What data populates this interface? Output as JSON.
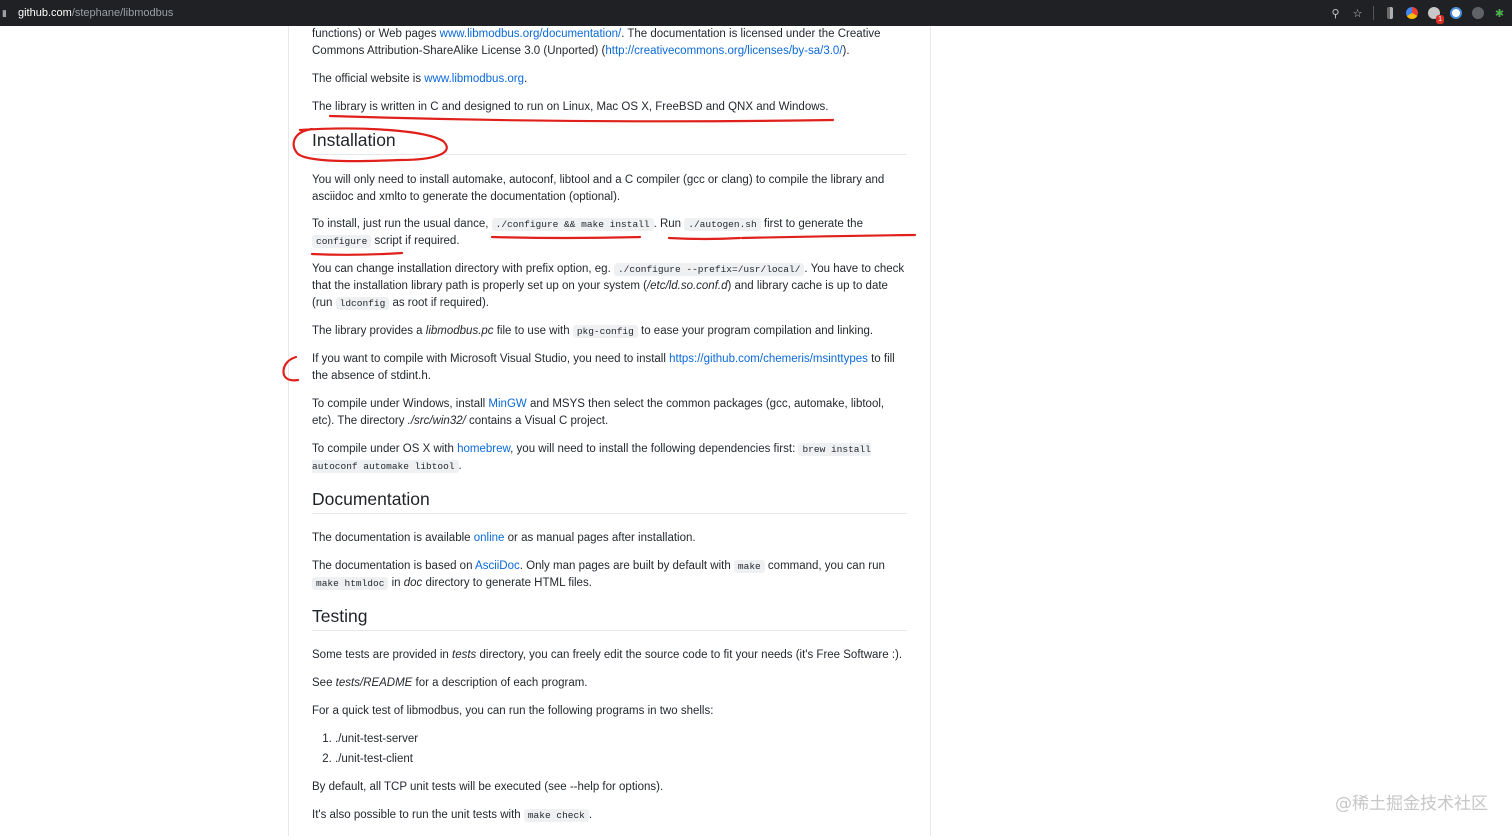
{
  "browser": {
    "url_host": "github.com",
    "url_path": "/stephane/libmodbus",
    "ext_badge": "1"
  },
  "intro": {
    "p1a": "functions) or Web pages ",
    "p1_link": "www.libmodbus.org/documentation/",
    "p1b": ". The documentation is licensed under the Creative Commons Attribution-ShareAlike License 3.0 (Unported) (",
    "p1_link2": "http://creativecommons.org/licenses/by-sa/3.0/",
    "p1c": ").",
    "p2a": "The official website is ",
    "p2_link": "www.libmodbus.org",
    "p2b": ".",
    "p3": "The library is written in C and designed to run on Linux, Mac OS X, FreeBSD and QNX and Windows."
  },
  "installation": {
    "heading": "Installation",
    "p1": "You will only need to install automake, autoconf, libtool and a C compiler (gcc or clang) to compile the library and asciidoc and xmlto to generate the documentation (optional).",
    "p2a": "To install, just run the usual dance, ",
    "p2_code1": "./configure && make install",
    "p2b": ". Run ",
    "p2_code2": "./autogen.sh",
    "p2c": " first to generate the ",
    "p2_code3": "configure",
    "p2d": " script if required.",
    "p3a": "You can change installation directory with prefix option, eg. ",
    "p3_code1": "./configure --prefix=/usr/local/",
    "p3b": ". You have to check that the installation library path is properly set up on your system (",
    "p3_em": "/etc/ld.so.conf.d",
    "p3c": ") and library cache is up to date (run ",
    "p3_code2": "ldconfig",
    "p3d": " as root if required).",
    "p4a": "The library provides a ",
    "p4_em": "libmodbus.pc",
    "p4b": " file to use with ",
    "p4_code": "pkg-config",
    "p4c": " to ease your program compilation and linking.",
    "p5a": "If you want to compile with Microsoft Visual Studio, you need to install ",
    "p5_link": "https://github.com/chemeris/msinttypes",
    "p5b": " to fill the absence of stdint.h.",
    "p6a": "To compile under Windows, install ",
    "p6_link": "MinGW",
    "p6b": " and MSYS then select the common packages (gcc, automake, libtool, etc). The directory ",
    "p6_em": "./src/win32/",
    "p6c": " contains a Visual C project.",
    "p7a": "To compile under OS X with ",
    "p7_link": "homebrew",
    "p7b": ", you will need to install the following dependencies first: ",
    "p7_code": "brew install autoconf automake libtool",
    "p7c": "."
  },
  "documentation": {
    "heading": "Documentation",
    "p1a": "The documentation is available ",
    "p1_link": "online",
    "p1b": " or as manual pages after installation.",
    "p2a": "The documentation is based on ",
    "p2_link": "AsciiDoc",
    "p2b": ". Only man pages are built by default with ",
    "p2_code1": "make",
    "p2c": " command, you can run ",
    "p2_code2": "make htmldoc",
    "p2d": " in ",
    "p2_em": "doc",
    "p2e": " directory to generate HTML files."
  },
  "testing": {
    "heading": "Testing",
    "p1a": "Some tests are provided in ",
    "p1_em": "tests",
    "p1b": " directory, you can freely edit the source code to fit your needs (it's Free Software :).",
    "p2a": "See ",
    "p2_em": "tests/README",
    "p2b": " for a description of each program.",
    "p3": "For a quick test of libmodbus, you can run the following programs in two shells:",
    "steps": [
      "./unit-test-server",
      "./unit-test-client"
    ],
    "p4": "By default, all TCP unit tests will be executed (see --help for options).",
    "p5a": "It's also possible to run the unit tests with ",
    "p5_code": "make check",
    "p5b": "."
  },
  "watermark": "@稀土掘金技术社区",
  "annotation_color": "#e0201a"
}
